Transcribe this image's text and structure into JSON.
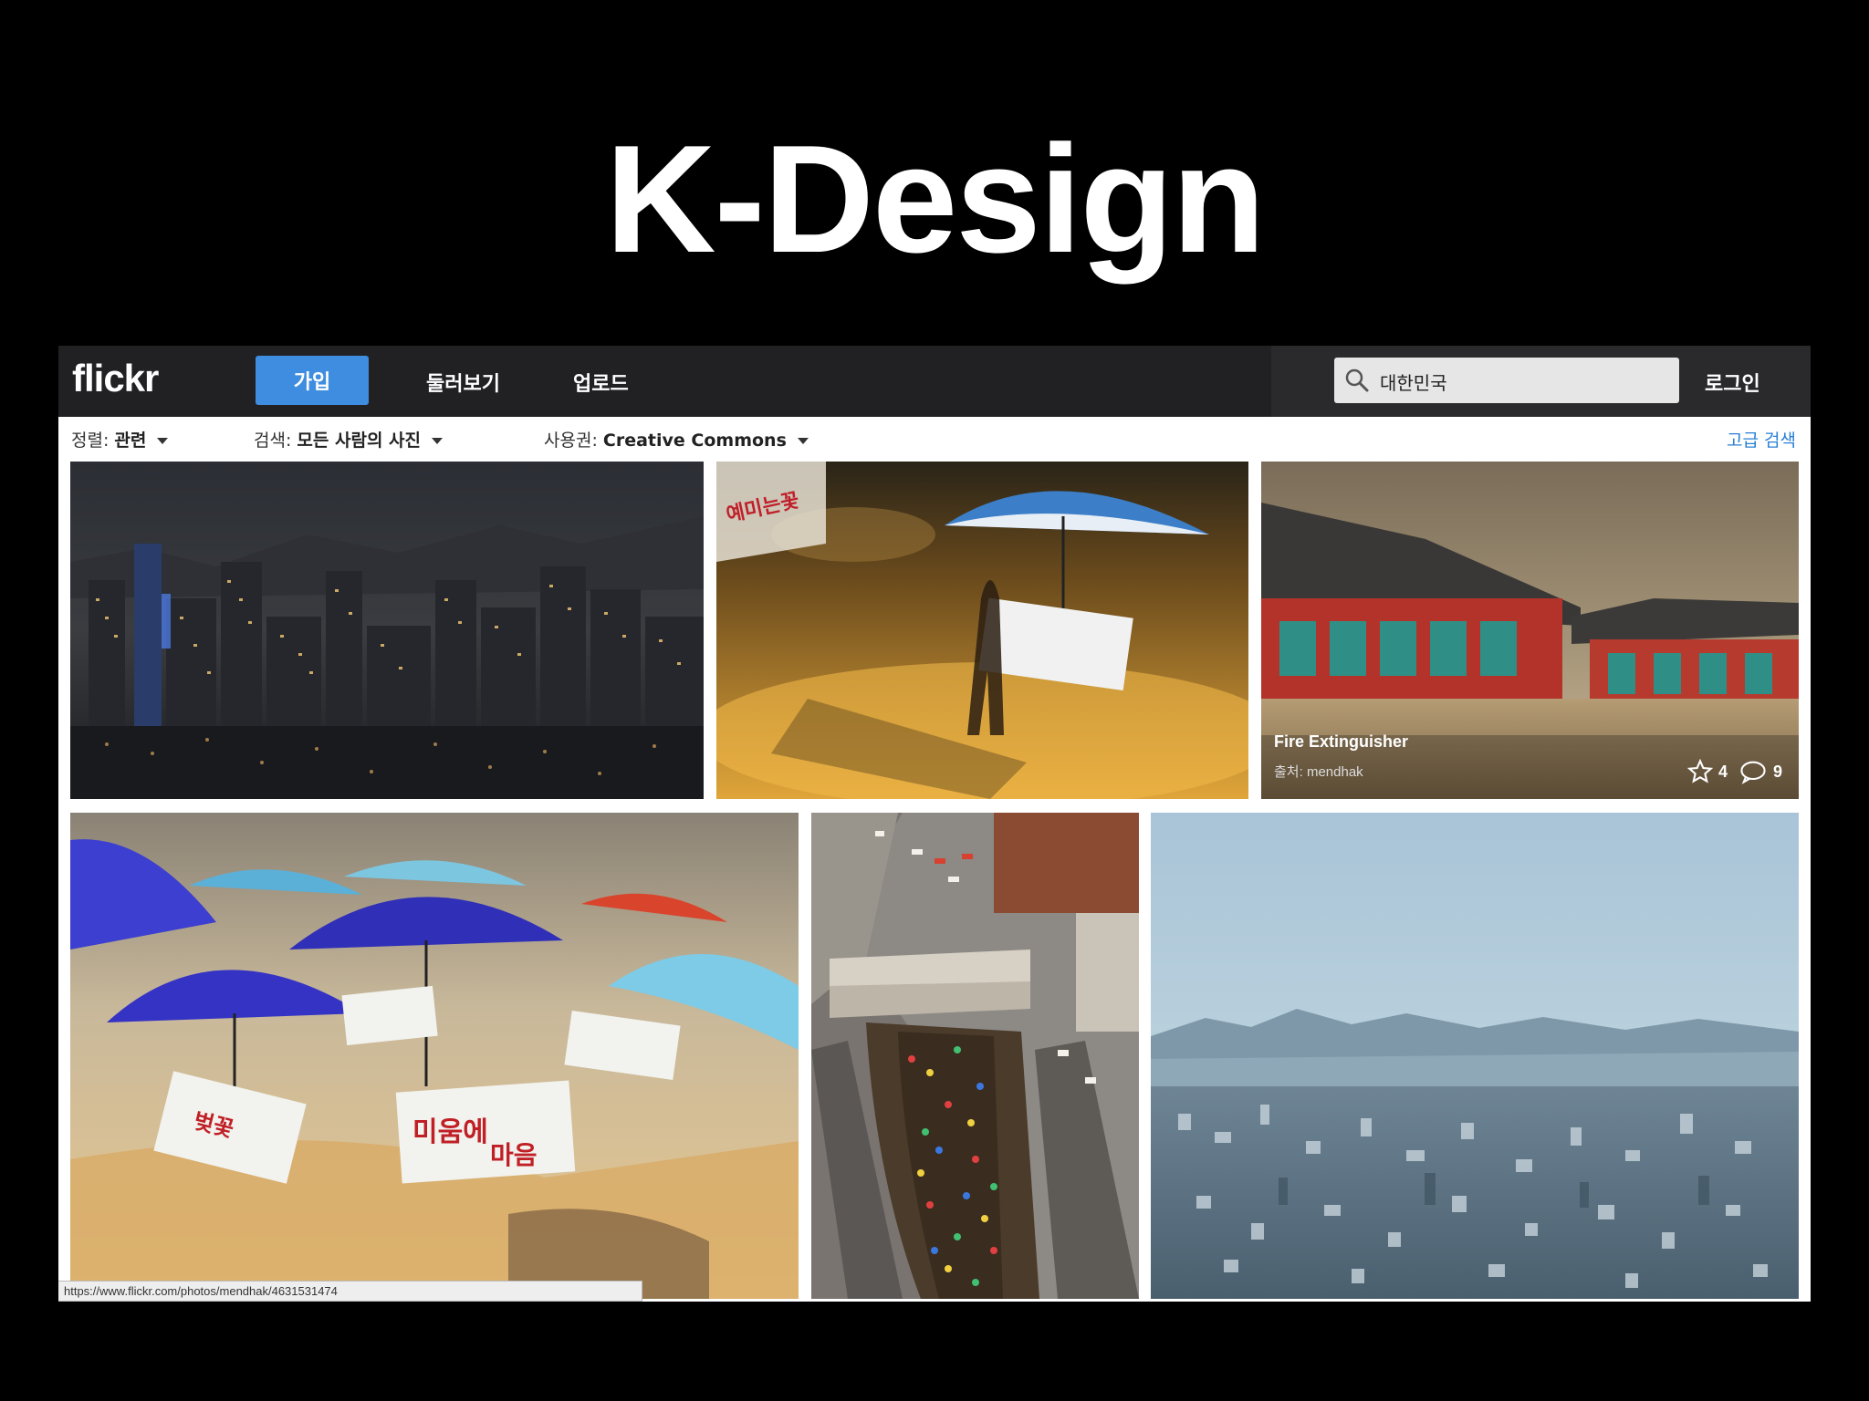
{
  "slide": {
    "title": "K-Design"
  },
  "topbar": {
    "logo": "flickr",
    "join_label": "가입",
    "nav": [
      "둘러보기",
      "업로드"
    ],
    "search_value": "대한민국",
    "login_label": "로그인"
  },
  "filters": {
    "sort_label": "정렬:",
    "sort_value": "관련",
    "search_label": "검색:",
    "search_value": "모든 사람의 사진",
    "license_label": "사용권:",
    "license_value": "Creative Commons",
    "advanced_label": "고급 검색"
  },
  "photos": [
    {
      "subject": "seoul-night-skyline"
    },
    {
      "subject": "umbrella-silhouette"
    },
    {
      "subject": "palace",
      "title": "Fire Extinguisher",
      "author_prefix": "출처:",
      "author": "mendhak",
      "favorites": "4",
      "comments": "9"
    },
    {
      "subject": "blue-umbrellas-signs"
    },
    {
      "subject": "cheonggyecheon-aerial"
    },
    {
      "subject": "seoul-haze-panorama"
    }
  ],
  "status_bar": {
    "url": "https://www.flickr.com/photos/mendhak/4631531474"
  },
  "colors": {
    "accent": "#3f8de0",
    "topbar": "#212124",
    "link": "#2a7fd4"
  }
}
